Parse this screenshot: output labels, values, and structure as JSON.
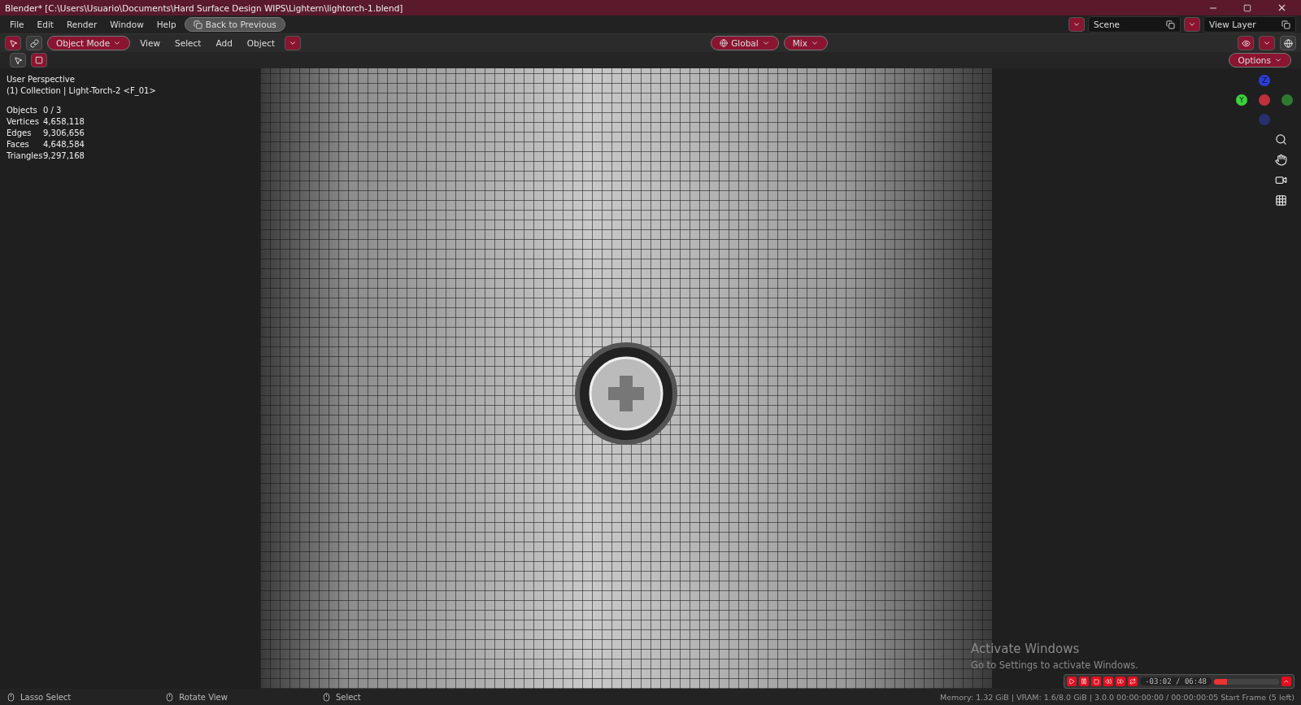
{
  "window": {
    "title": "Blender* [C:\\Users\\Usuario\\Documents\\Hard Surface Design WIPS\\Lightern\\lightorch-1.blend]"
  },
  "menu": [
    "File",
    "Edit",
    "Render",
    "Window",
    "Help"
  ],
  "back_button": "Back to Previous",
  "scene": {
    "label": "Scene"
  },
  "view_layer": {
    "label": "View Layer"
  },
  "header": {
    "mode": "Object Mode",
    "menus": [
      "View",
      "Select",
      "Add",
      "Object"
    ],
    "orientation": "Global",
    "pivot": "Mix",
    "options": "Options"
  },
  "overlay": {
    "view_name": "User Perspective",
    "collection": "(1) Collection | Light-Torch-2 <F_01>",
    "stats": [
      {
        "label": "Objects",
        "value": "0 / 3"
      },
      {
        "label": "Vertices",
        "value": "4,658,118"
      },
      {
        "label": "Edges",
        "value": "9,306,656"
      },
      {
        "label": "Faces",
        "value": "4,648,584"
      },
      {
        "label": "Triangles",
        "value": "9,297,168"
      }
    ]
  },
  "gizmo": {
    "z": "Z",
    "y": "Y"
  },
  "activation": {
    "title": "Activate Windows",
    "subtitle": "Go to Settings to activate Windows."
  },
  "player": {
    "time": "-03:02 / 06:48",
    "level": 0.2
  },
  "status_bar": {
    "items": [
      "Lasso Select",
      "Rotate View",
      "Select"
    ],
    "info": "Memory: 1.32 GiB | VRAM: 1.6/8.0 GiB | 3.0.0   00:00:00:00 / 00:00:00:05  Start Frame (5 left)"
  }
}
